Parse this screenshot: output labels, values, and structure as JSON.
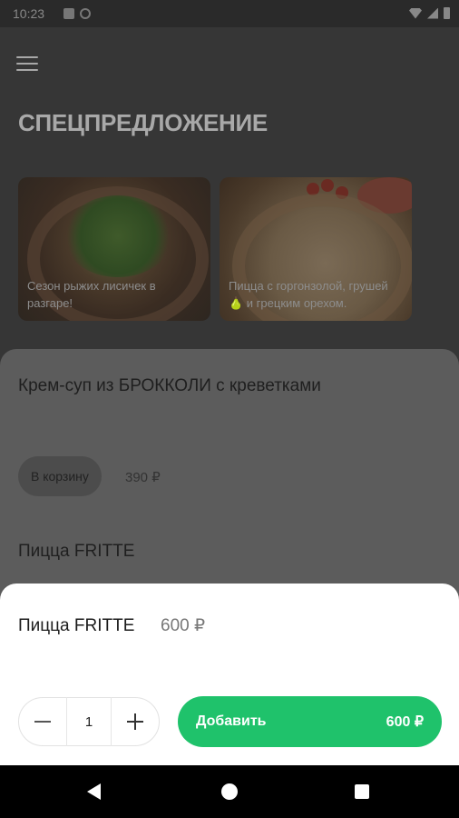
{
  "status_bar": {
    "time": "10:23"
  },
  "header": {
    "title": "СПЕЦПРЕДЛОЖЕНИЕ"
  },
  "promos": [
    {
      "caption": "Сезон рыжих лисичек в разгаре!"
    },
    {
      "caption": "Пицца с горгонзолой, грушей 🍐 и грецким орехом."
    }
  ],
  "menu_list": {
    "items": [
      {
        "name": "Крем-суп из БРОККОЛИ с креветками",
        "cart_label": "В корзину",
        "price": "390 ₽"
      },
      {
        "name": "Пицца FRITTE"
      }
    ]
  },
  "dialog": {
    "name": "Пицца FRITTE",
    "price": "600 ₽",
    "quantity": "1",
    "add_label": "Добавить",
    "add_price": "600 ₽"
  },
  "colors": {
    "accent": "#1fc26b",
    "overlay": "#363636"
  },
  "icons": [
    "menu-icon",
    "minus-icon",
    "plus-icon",
    "back-icon",
    "home-icon",
    "recents-icon"
  ]
}
